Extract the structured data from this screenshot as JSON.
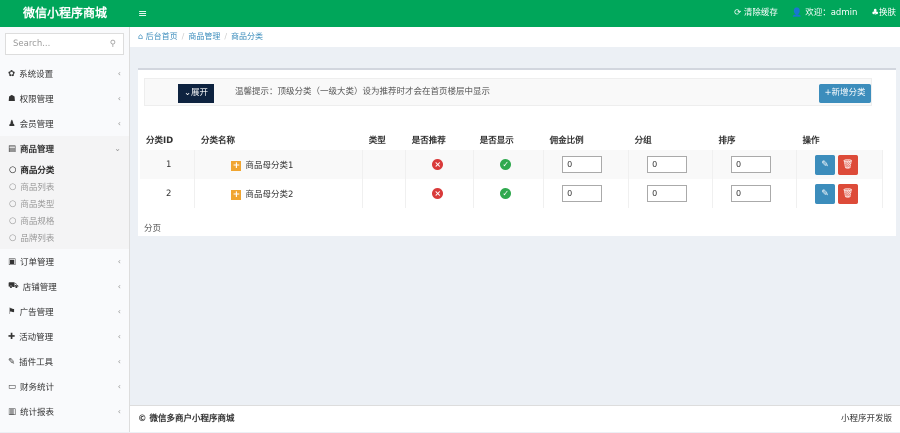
{
  "header": {
    "logo": "微信小程序商城",
    "menu_icon": "≡",
    "clear_cache": "清除缓存",
    "welcome": "欢迎：admin",
    "skin": "换肤"
  },
  "sidebar": {
    "search_placeholder": "Search...",
    "items": [
      {
        "icon": "✿",
        "label": "系统设置"
      },
      {
        "icon": "☗",
        "label": "权限管理"
      },
      {
        "icon": "♟",
        "label": "会员管理"
      },
      {
        "icon": "▤",
        "label": "商品管理",
        "open": true
      },
      {
        "icon": "▣",
        "label": "订单管理"
      },
      {
        "icon": "⛟",
        "label": "店铺管理"
      },
      {
        "icon": "⚑",
        "label": "广告管理"
      },
      {
        "icon": "✚",
        "label": "活动管理"
      },
      {
        "icon": "✎",
        "label": "插件工具"
      },
      {
        "icon": "▭",
        "label": "财务统计"
      },
      {
        "icon": "▥",
        "label": "统计报表"
      }
    ],
    "subitems": [
      "商品分类",
      "商品列表",
      "商品类型",
      "商品规格",
      "品牌列表"
    ]
  },
  "breadcrumb": [
    "后台首页",
    "商品管理",
    "商品分类"
  ],
  "toolbar": {
    "expand": "⌄展开",
    "tip": "温馨提示：顶级分类（一级大类）设为推荐时才会在首页楼层中显示",
    "add": "+新增分类"
  },
  "table": {
    "headers": [
      "分类ID",
      "分类名称",
      "类型",
      "是否推荐",
      "是否显示",
      "佣金比例",
      "分组",
      "排序",
      "操作"
    ],
    "rows": [
      {
        "id": "1",
        "name": "商品母分类1",
        "type": "",
        "recommend": false,
        "show": true,
        "commission": "0",
        "group": "0",
        "sort": "0"
      },
      {
        "id": "2",
        "name": "商品母分类2",
        "type": "",
        "recommend": false,
        "show": true,
        "commission": "0",
        "group": "0",
        "sort": "0"
      }
    ]
  },
  "pagination": "分页",
  "footer": {
    "left": "© 微信多商户小程序商城",
    "right": "小程序开发版"
  }
}
